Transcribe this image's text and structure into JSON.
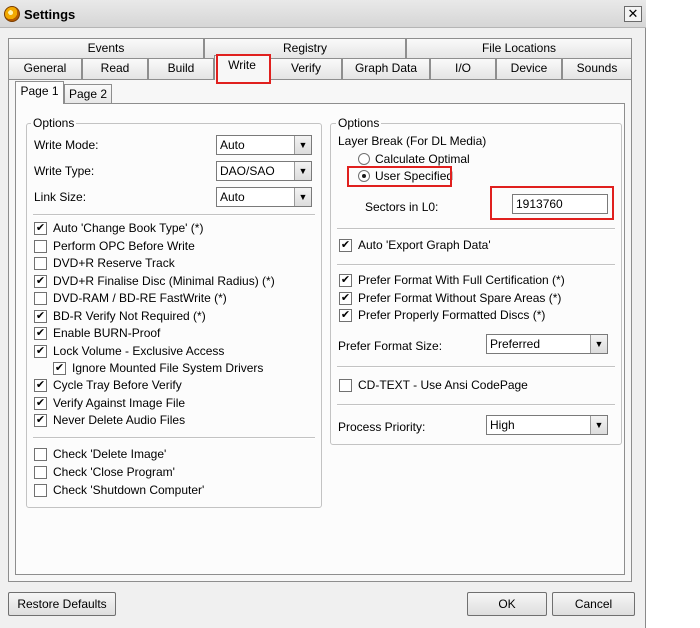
{
  "window": {
    "title": "Settings",
    "close_glyph": "✕"
  },
  "background_text": "... ... .... ... ...",
  "tabs_row1": [
    "Events",
    "Registry",
    "File Locations"
  ],
  "tabs_row2": [
    "General",
    "Read",
    "Build",
    "Write",
    "Verify",
    "Graph Data",
    "I/O",
    "Device",
    "Sounds"
  ],
  "active_tab": "Write",
  "subtabs": [
    "Page 1",
    "Page 2"
  ],
  "left_group": {
    "label": "Options",
    "write_mode": {
      "label": "Write Mode:",
      "value": "Auto"
    },
    "write_type": {
      "label": "Write Type:",
      "value": "DAO/SAO"
    },
    "link_size": {
      "label": "Link Size:",
      "value": "Auto"
    },
    "checkboxes": [
      {
        "label": "Auto 'Change Book Type' (*)",
        "checked": true
      },
      {
        "label": "Perform OPC Before Write",
        "checked": false
      },
      {
        "label": "DVD+R Reserve Track",
        "checked": false
      },
      {
        "label": "DVD+R Finalise Disc (Minimal Radius) (*)",
        "checked": true
      },
      {
        "label": "DVD-RAM / BD-RE FastWrite (*)",
        "checked": false
      },
      {
        "label": "BD-R Verify Not Required (*)",
        "checked": true
      },
      {
        "label": "Enable BURN-Proof",
        "checked": true
      },
      {
        "label": "Lock Volume - Exclusive Access",
        "checked": true
      },
      {
        "label": "Ignore Mounted File System Drivers",
        "checked": true
      },
      {
        "label": "Cycle Tray Before Verify",
        "checked": true
      },
      {
        "label": "Verify Against Image File",
        "checked": true
      },
      {
        "label": "Never Delete Audio Files",
        "checked": true
      }
    ],
    "checkboxes2": [
      {
        "label": "Check 'Delete Image'",
        "checked": false
      },
      {
        "label": "Check 'Close Program'",
        "checked": false
      },
      {
        "label": "Check 'Shutdown Computer'",
        "checked": false
      }
    ]
  },
  "right_group": {
    "label": "Options",
    "layer_break_label": "Layer Break (For DL Media)",
    "radio_calculate": "Calculate Optimal",
    "radio_user": "User Specified",
    "selected_radio": "user",
    "sectors_label": "Sectors in L0:",
    "sectors_value": "1913760",
    "auto_export": {
      "label": "Auto 'Export Graph Data'",
      "checked": true
    },
    "prefer_checks": [
      {
        "label": "Prefer Format With Full Certification (*)",
        "checked": true
      },
      {
        "label": "Prefer Format Without Spare Areas (*)",
        "checked": true
      },
      {
        "label": "Prefer Properly Formatted Discs (*)",
        "checked": true
      }
    ],
    "prefer_format_size": {
      "label": "Prefer Format Size:",
      "value": "Preferred"
    },
    "cd_text": {
      "label": "CD-TEXT - Use Ansi CodePage",
      "checked": false
    },
    "process_priority": {
      "label": "Process Priority:",
      "value": "High"
    }
  },
  "buttons": {
    "restore": "Restore Defaults",
    "ok": "OK",
    "cancel": "Cancel"
  },
  "glyphs": {
    "check": "✔",
    "combo_arrow": "▼"
  },
  "highlight_color": "#e0201e"
}
